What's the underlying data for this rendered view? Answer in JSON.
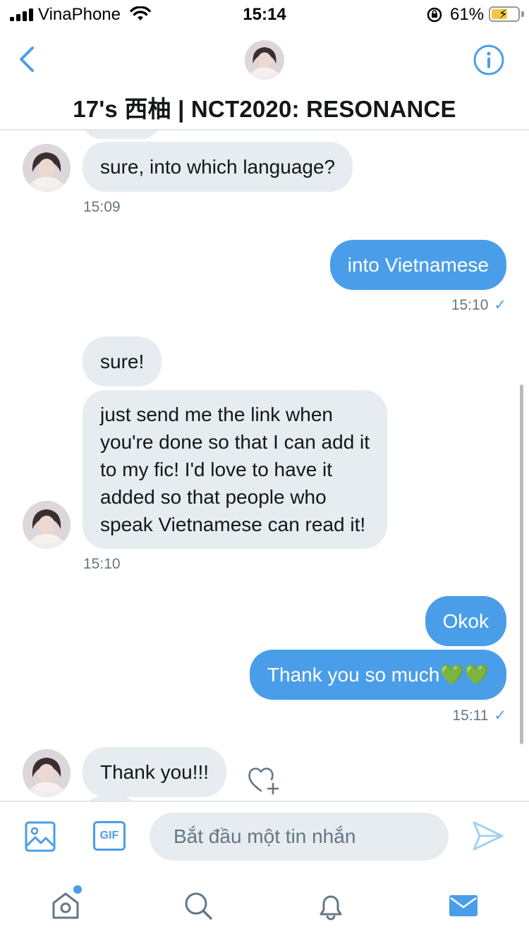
{
  "status_bar": {
    "carrier": "VinaPhone",
    "time": "15:14",
    "battery_percent": "61%",
    "battery_level": 0.61,
    "icons": [
      "signal-icon",
      "wifi-icon",
      "orientation-lock-icon",
      "battery-charging-icon"
    ]
  },
  "header": {
    "title": "17's 西柚 | NCT2020: RESONANCE",
    "icons": [
      "back-chevron-icon",
      "info-icon"
    ]
  },
  "messages": [
    {
      "direction": "in",
      "text": "sure, into which language?"
    },
    {
      "direction": "in",
      "time": "15:09"
    },
    {
      "direction": "out",
      "text": "into Vietnamese"
    },
    {
      "direction": "out",
      "time": "15:10",
      "read_tick": "✓"
    },
    {
      "direction": "in",
      "text": "sure!"
    },
    {
      "direction": "in",
      "lines": [
        "just send me the link when",
        "you're done so that I can add it",
        "to my fic! I'd love to have it",
        "added so that people who",
        "speak Vietnamese can read it!"
      ]
    },
    {
      "direction": "in",
      "time": "15:10"
    },
    {
      "direction": "out",
      "text": "Okok"
    },
    {
      "direction": "out",
      "text": "Thank you so much💚💚"
    },
    {
      "direction": "out",
      "time": "15:11",
      "read_tick": "✓"
    },
    {
      "direction": "in",
      "text": "Thank you!!!"
    }
  ],
  "composer": {
    "placeholder": "Bắt đầu một tin nhắn",
    "gif_label": "GIF",
    "icons": [
      "image-icon",
      "gif-icon",
      "send-icon"
    ]
  },
  "colors": {
    "accent": "#4a9ee9",
    "incoming_bubble": "#e6ecf0",
    "secondary_text": "#657786"
  },
  "tab_bar": {
    "icons": [
      "home-icon",
      "search-icon",
      "notifications-icon",
      "messages-icon"
    ],
    "active": "messages-icon"
  }
}
